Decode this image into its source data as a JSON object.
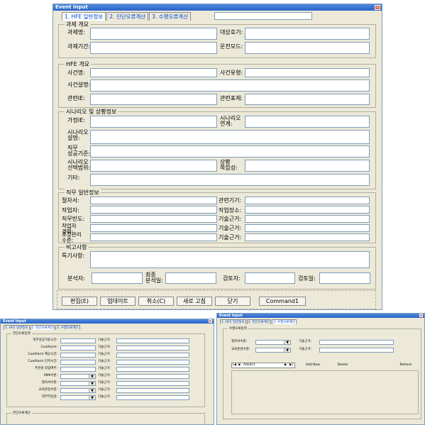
{
  "main": {
    "title": "Event Input",
    "close_glyph": "✕",
    "tabs": [
      "1. HFE 일반정보",
      "2. 진단오류계산",
      "3. 수행오류계산"
    ],
    "group_overview": {
      "title": "과제 개요",
      "task_name": "과제명:",
      "target_unit": "대상호기:",
      "task_period": "과제기간:",
      "operation_mode": "운전모드:"
    },
    "group_hfe": {
      "title": "HFE 개요",
      "event_name": "사건명:",
      "event_type": "사건유형:",
      "event_desc": "사건설명:",
      "related_ie": "관련IE:",
      "related_table": "관련표제:"
    },
    "group_scenario": {
      "title": "시나리오 및 상황정보",
      "assumed_ie": "가정IE:",
      "scenario_link": "시나리오\n연계:",
      "scenario_desc": "시나리오\n설명:",
      "success_criteria": "직무\n성공기준:",
      "scenario_selection": "시나리오\n선택범위:",
      "situation_complexity": "상황\n복잡성:",
      "other": "기타:"
    },
    "group_task": {
      "title": "직무 일반정보",
      "procedure": "절차서:",
      "related_equipment": "관련기기:",
      "operator": "작업자:",
      "work_place": "작업장소:",
      "task_frequency": "직무빈도:",
      "basis": "기술근거:",
      "operator_careers": "작업자\n경력:",
      "control_points": "조정관리\n수준:"
    },
    "group_remarks": {
      "title": "비고사항",
      "special_notes": "특기사항:",
      "analyst": "분석자:",
      "final_analysis_date": "최종\n분석일:",
      "reviewer": "검토자:",
      "review_date": "검토일:"
    },
    "buttons": [
      "편집(E)",
      "업데이트",
      "취소(C)",
      "새로 고침",
      "닫기",
      "Command1"
    ]
  },
  "diag": {
    "title": "Event Input",
    "close_glyph": "✕",
    "tabs": [
      "1. HFE 일반정보",
      "2. 진단오류계산",
      "3. 수행오류계산"
    ],
    "group_title": "진단오류입력",
    "rows": [
      {
        "label": "직무성공가용시간:",
        "basis": "기술근거:"
      },
      {
        "label": "CueAlarm:",
        "basis": "기술근거:"
      },
      {
        "label": "CueAlarm 제공시간:",
        "basis": "기술근거:"
      },
      {
        "label": "CueAlarm 인지시간:",
        "basis": "기술근거:"
      },
      {
        "label": "주관성 작업여부:",
        "basis": "기술근거:"
      },
      {
        "label": "MMI수준:",
        "basis": "기술근거:"
      },
      {
        "label": "절차서수준:",
        "basis": "기술근거:"
      },
      {
        "label": "교육훈련수준:",
        "basis": "기술근거:"
      },
      {
        "label": "직무부담감:",
        "basis": "기술근거:"
      }
    ],
    "bottom_group_title": "진단오류계산"
  },
  "perf": {
    "title": "Event Input",
    "close_glyph": "✕",
    "tabs": [
      "1. HFE 일반정보",
      "2. 진단오류계산",
      "3. 수행오류계산"
    ],
    "group_title": "수행오류입력",
    "rows": [
      {
        "label": "절차서수준:",
        "basis": "기술근거:"
      },
      {
        "label": "교육훈련수준:",
        "basis": "기술근거:"
      }
    ],
    "adodc_caption": "Adodc1",
    "nav_glyphs": [
      "|◀",
      "◀",
      "▶",
      "▶|"
    ],
    "add_new": "Add New",
    "delete": "Delete",
    "refresh": "Refresh"
  }
}
